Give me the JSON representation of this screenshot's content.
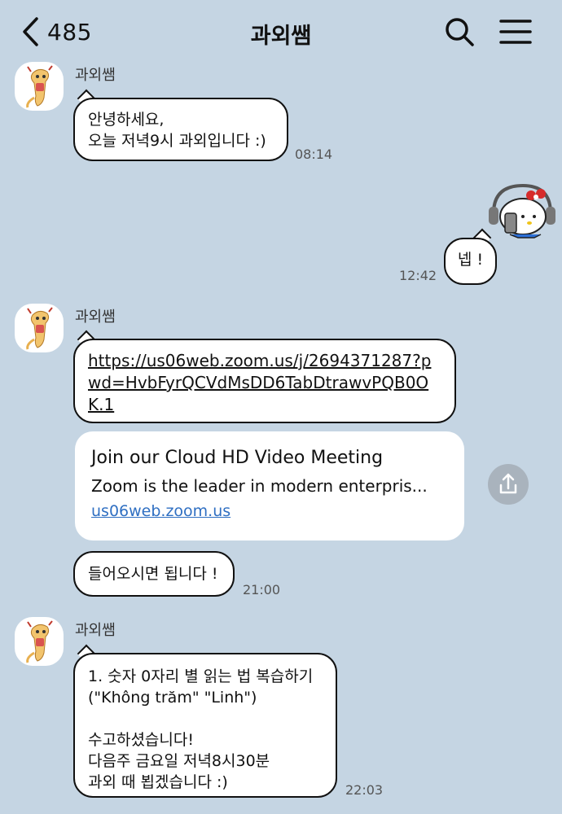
{
  "header": {
    "back_count": "485",
    "title": "과외쌤"
  },
  "icons": {
    "back": "chevron-left-icon",
    "search": "search-icon",
    "menu": "hamburger-menu-icon",
    "share": "share-icon"
  },
  "messages": [
    {
      "sender": "과외쌤",
      "lines": [
        "안녕하세요,",
        "오늘 저녁9시 과외입니다 :)"
      ],
      "time": "08:14"
    },
    {
      "sender": "me",
      "sticker": "hello-kitty-headphones-sticker",
      "text": "넵 !",
      "time": "12:42"
    },
    {
      "sender": "과외쌤",
      "link": "https://us06web.zoom.us/j/2694371287?pwd=HvbFyrQCVdMsDD6TabDtrawvPQB0OK.1",
      "preview": {
        "title": "Join our Cloud HD Video Meeting",
        "description": "Zoom is the leader in modern enterpris...",
        "domain": "us06web.zoom.us"
      },
      "followup": "들어오시면 됩니다 !",
      "time": "21:00"
    },
    {
      "sender": "과외쌤",
      "lines": [
        "1. 숫자 0자리 별 읽는 법 복습하기",
        "(\"Không trăm\" \"Linh\")",
        "",
        "수고하셨습니다!",
        "다음주 금요일 저녁8시30분",
        "과외 때 뵙겠습니다 :)"
      ],
      "time": "22:03"
    }
  ],
  "colors": {
    "background": "#c5d5e3",
    "bubble": "#ffffff",
    "link_preview_domain": "#2f6fc2",
    "share_button": "#a9b3bd"
  }
}
